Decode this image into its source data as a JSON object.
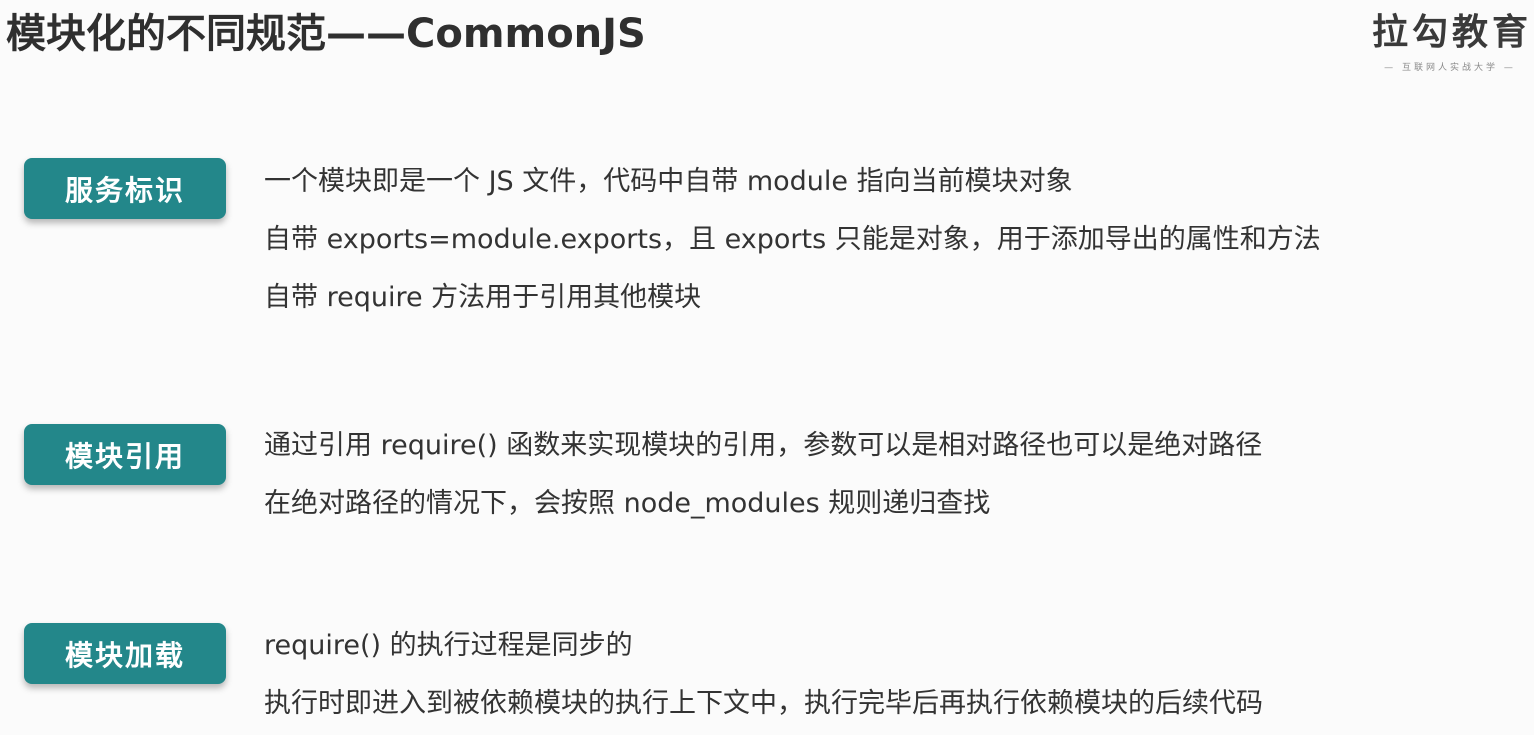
{
  "header": {
    "title": "模块化的不同规范——CommonJS"
  },
  "brand": {
    "name": "拉勾教育",
    "slogan": "— 互联网人实战大学 —"
  },
  "sections": [
    {
      "badge": "服务标识",
      "lines": [
        "一个模块即是一个 JS 文件，代码中自带 module 指向当前模块对象",
        "自带 exports=module.exports，且 exports 只能是对象，用于添加导出的属性和方法",
        "自带 require 方法用于引用其他模块"
      ]
    },
    {
      "badge": "模块引用",
      "lines": [
        "通过引用 require() 函数来实现模块的引用，参数可以是相对路径也可以是绝对路径",
        "在绝对路径的情况下，会按照 node_modules 规则递归查找"
      ]
    },
    {
      "badge": "模块加载",
      "lines": [
        "require() 的执行过程是同步的",
        "执行时即进入到被依赖模块的执行上下文中，执行完毕后再执行依赖模块的后续代码"
      ]
    }
  ]
}
